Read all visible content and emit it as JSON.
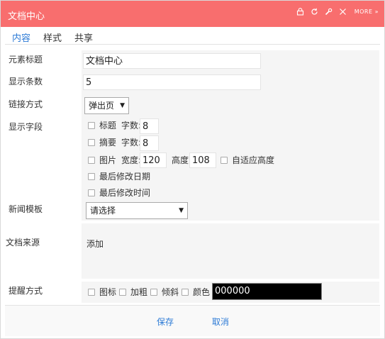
{
  "window": {
    "title": "文档中心",
    "more_label": "MORE",
    "more_arrows": "»"
  },
  "tabs": [
    {
      "label": "内容"
    },
    {
      "label": "样式"
    },
    {
      "label": "共享"
    }
  ],
  "form": {
    "element_title": {
      "label": "元素标题",
      "value": "文档中心"
    },
    "display_count": {
      "label": "显示条数",
      "value": "5"
    },
    "link_mode": {
      "label": "链接方式",
      "value": "弹出页"
    },
    "display_fields": {
      "label": "显示字段",
      "title": {
        "label": "标题",
        "chars_label": "字数:",
        "chars_value": "8"
      },
      "summary": {
        "label": "摘要",
        "chars_label": "字数:",
        "chars_value": "8"
      },
      "image": {
        "label": "图片",
        "width_label": "宽度:",
        "width_value": "120",
        "height_label": "高度:",
        "height_value": "108",
        "auto_height_label": "自适应高度"
      },
      "last_modified_date": {
        "label": "最后修改日期"
      },
      "last_modified_time": {
        "label": "最后修改时间"
      }
    },
    "news_template": {
      "label": "新闻模板",
      "value": "请选择"
    },
    "doc_source": {
      "label": "文档来源",
      "add_label": "添加"
    },
    "reminder": {
      "label": "提醒方式",
      "icon_label": "图标",
      "bold_label": "加粗",
      "italic_label": "倾斜",
      "color_label": "颜色",
      "color_value": "000000"
    }
  },
  "footer": {
    "save_label": "保存",
    "cancel_label": "取消"
  },
  "colors": {
    "titlebar": "#f86e6e",
    "link": "#2d7bd6",
    "field_area": "#f5f5f5",
    "color_swatch": "#000000"
  }
}
